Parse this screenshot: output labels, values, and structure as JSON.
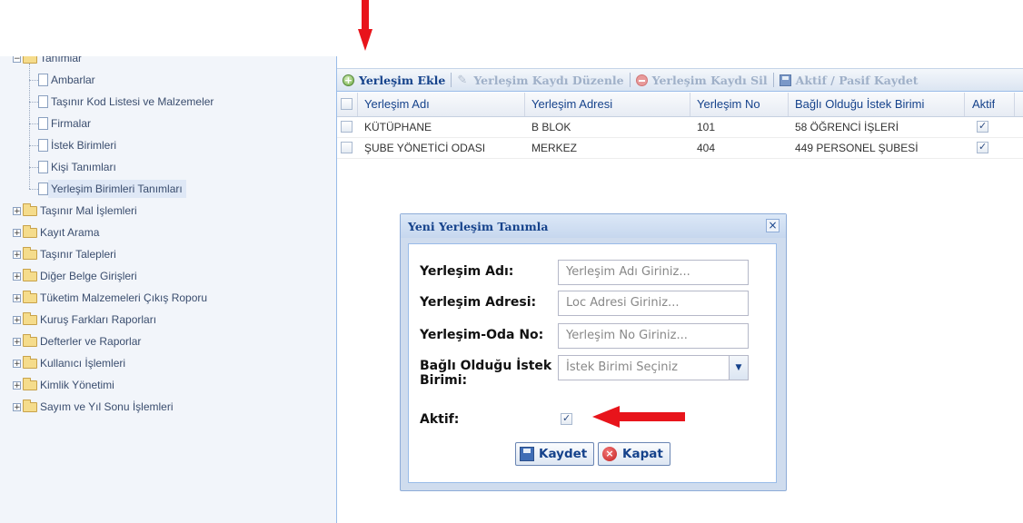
{
  "tree": {
    "items": [
      {
        "label": "Tanımlar",
        "type": "folder",
        "expander": "−"
      },
      {
        "label": "Ambarlar",
        "type": "leaf"
      },
      {
        "label": "Taşınır Kod Listesi ve Malzemeler",
        "type": "leaf"
      },
      {
        "label": "Firmalar",
        "type": "leaf"
      },
      {
        "label": "İstek Birimleri",
        "type": "leaf"
      },
      {
        "label": "Kişi Tanımları",
        "type": "leaf"
      },
      {
        "label": "Yerleşim Birimleri Tanımları",
        "type": "leaf",
        "selected": true
      },
      {
        "label": "Taşınır Mal İşlemleri",
        "type": "folder",
        "expander": "+"
      },
      {
        "label": "Kayıt Arama",
        "type": "folder",
        "expander": "+"
      },
      {
        "label": "Taşınır Talepleri",
        "type": "folder",
        "expander": "+"
      },
      {
        "label": "Diğer Belge Girişleri",
        "type": "folder",
        "expander": "+"
      },
      {
        "label": "Tüketim Malzemeleri Çıkış Roporu",
        "type": "folder",
        "expander": "+"
      },
      {
        "label": "Kuruş Farkları Raporları",
        "type": "folder",
        "expander": "+"
      },
      {
        "label": "Defterler ve Raporlar",
        "type": "folder",
        "expander": "+"
      },
      {
        "label": "Kullanıcı İşlemleri",
        "type": "folder",
        "expander": "+"
      },
      {
        "label": "Kimlik Yönetimi",
        "type": "folder",
        "expander": "+"
      },
      {
        "label": "Sayım ve Yıl Sonu İşlemleri",
        "type": "folder",
        "expander": "+"
      }
    ]
  },
  "toolbar": {
    "add_label": "Yerleşim Ekle",
    "edit_label": "Yerleşim Kaydı Düzenle",
    "delete_label": "Yerleşim Kaydı Sil",
    "save_label": "Aktif / Pasif Kaydet"
  },
  "grid": {
    "columns": [
      "Yerleşim Adı",
      "Yerleşim Adresi",
      "Yerleşim No",
      "Bağlı Olduğu İstek Birimi",
      "Aktif"
    ],
    "rows": [
      {
        "name": "KÜTÜPHANE",
        "address": "B BLOK",
        "no": "101",
        "unit": "58 ÖĞRENCİ İŞLERİ",
        "active": true
      },
      {
        "name": "ŞUBE YÖNETİCİ ODASI",
        "address": "MERKEZ",
        "no": "404",
        "unit": "449 PERSONEL ŞUBESİ",
        "active": true
      }
    ]
  },
  "dialog": {
    "title": "Yeni Yerleşim Tanımla",
    "close_glyph": "×",
    "name_label": "Yerleşim Adı:",
    "name_placeholder": "Yerleşim Adı Giriniz...",
    "address_label": "Yerleşim Adresi:",
    "address_placeholder": "Loc Adresi Giriniz...",
    "room_label": "Yerleşim-Oda No:",
    "room_placeholder": "Yerleşim No Giriniz...",
    "unit_label_line1": "Bağlı Olduğu İstek",
    "unit_label_line2": "Birimi:",
    "unit_placeholder": "İstek Birimi Seçiniz",
    "active_label": "Aktif:",
    "active_checked": true,
    "save_button": "Kaydet",
    "close_button": "Kapat"
  },
  "colors": {
    "annotation_arrow": "#e8141b",
    "header_text": "#15428b",
    "panel_border": "#99bbe8"
  }
}
